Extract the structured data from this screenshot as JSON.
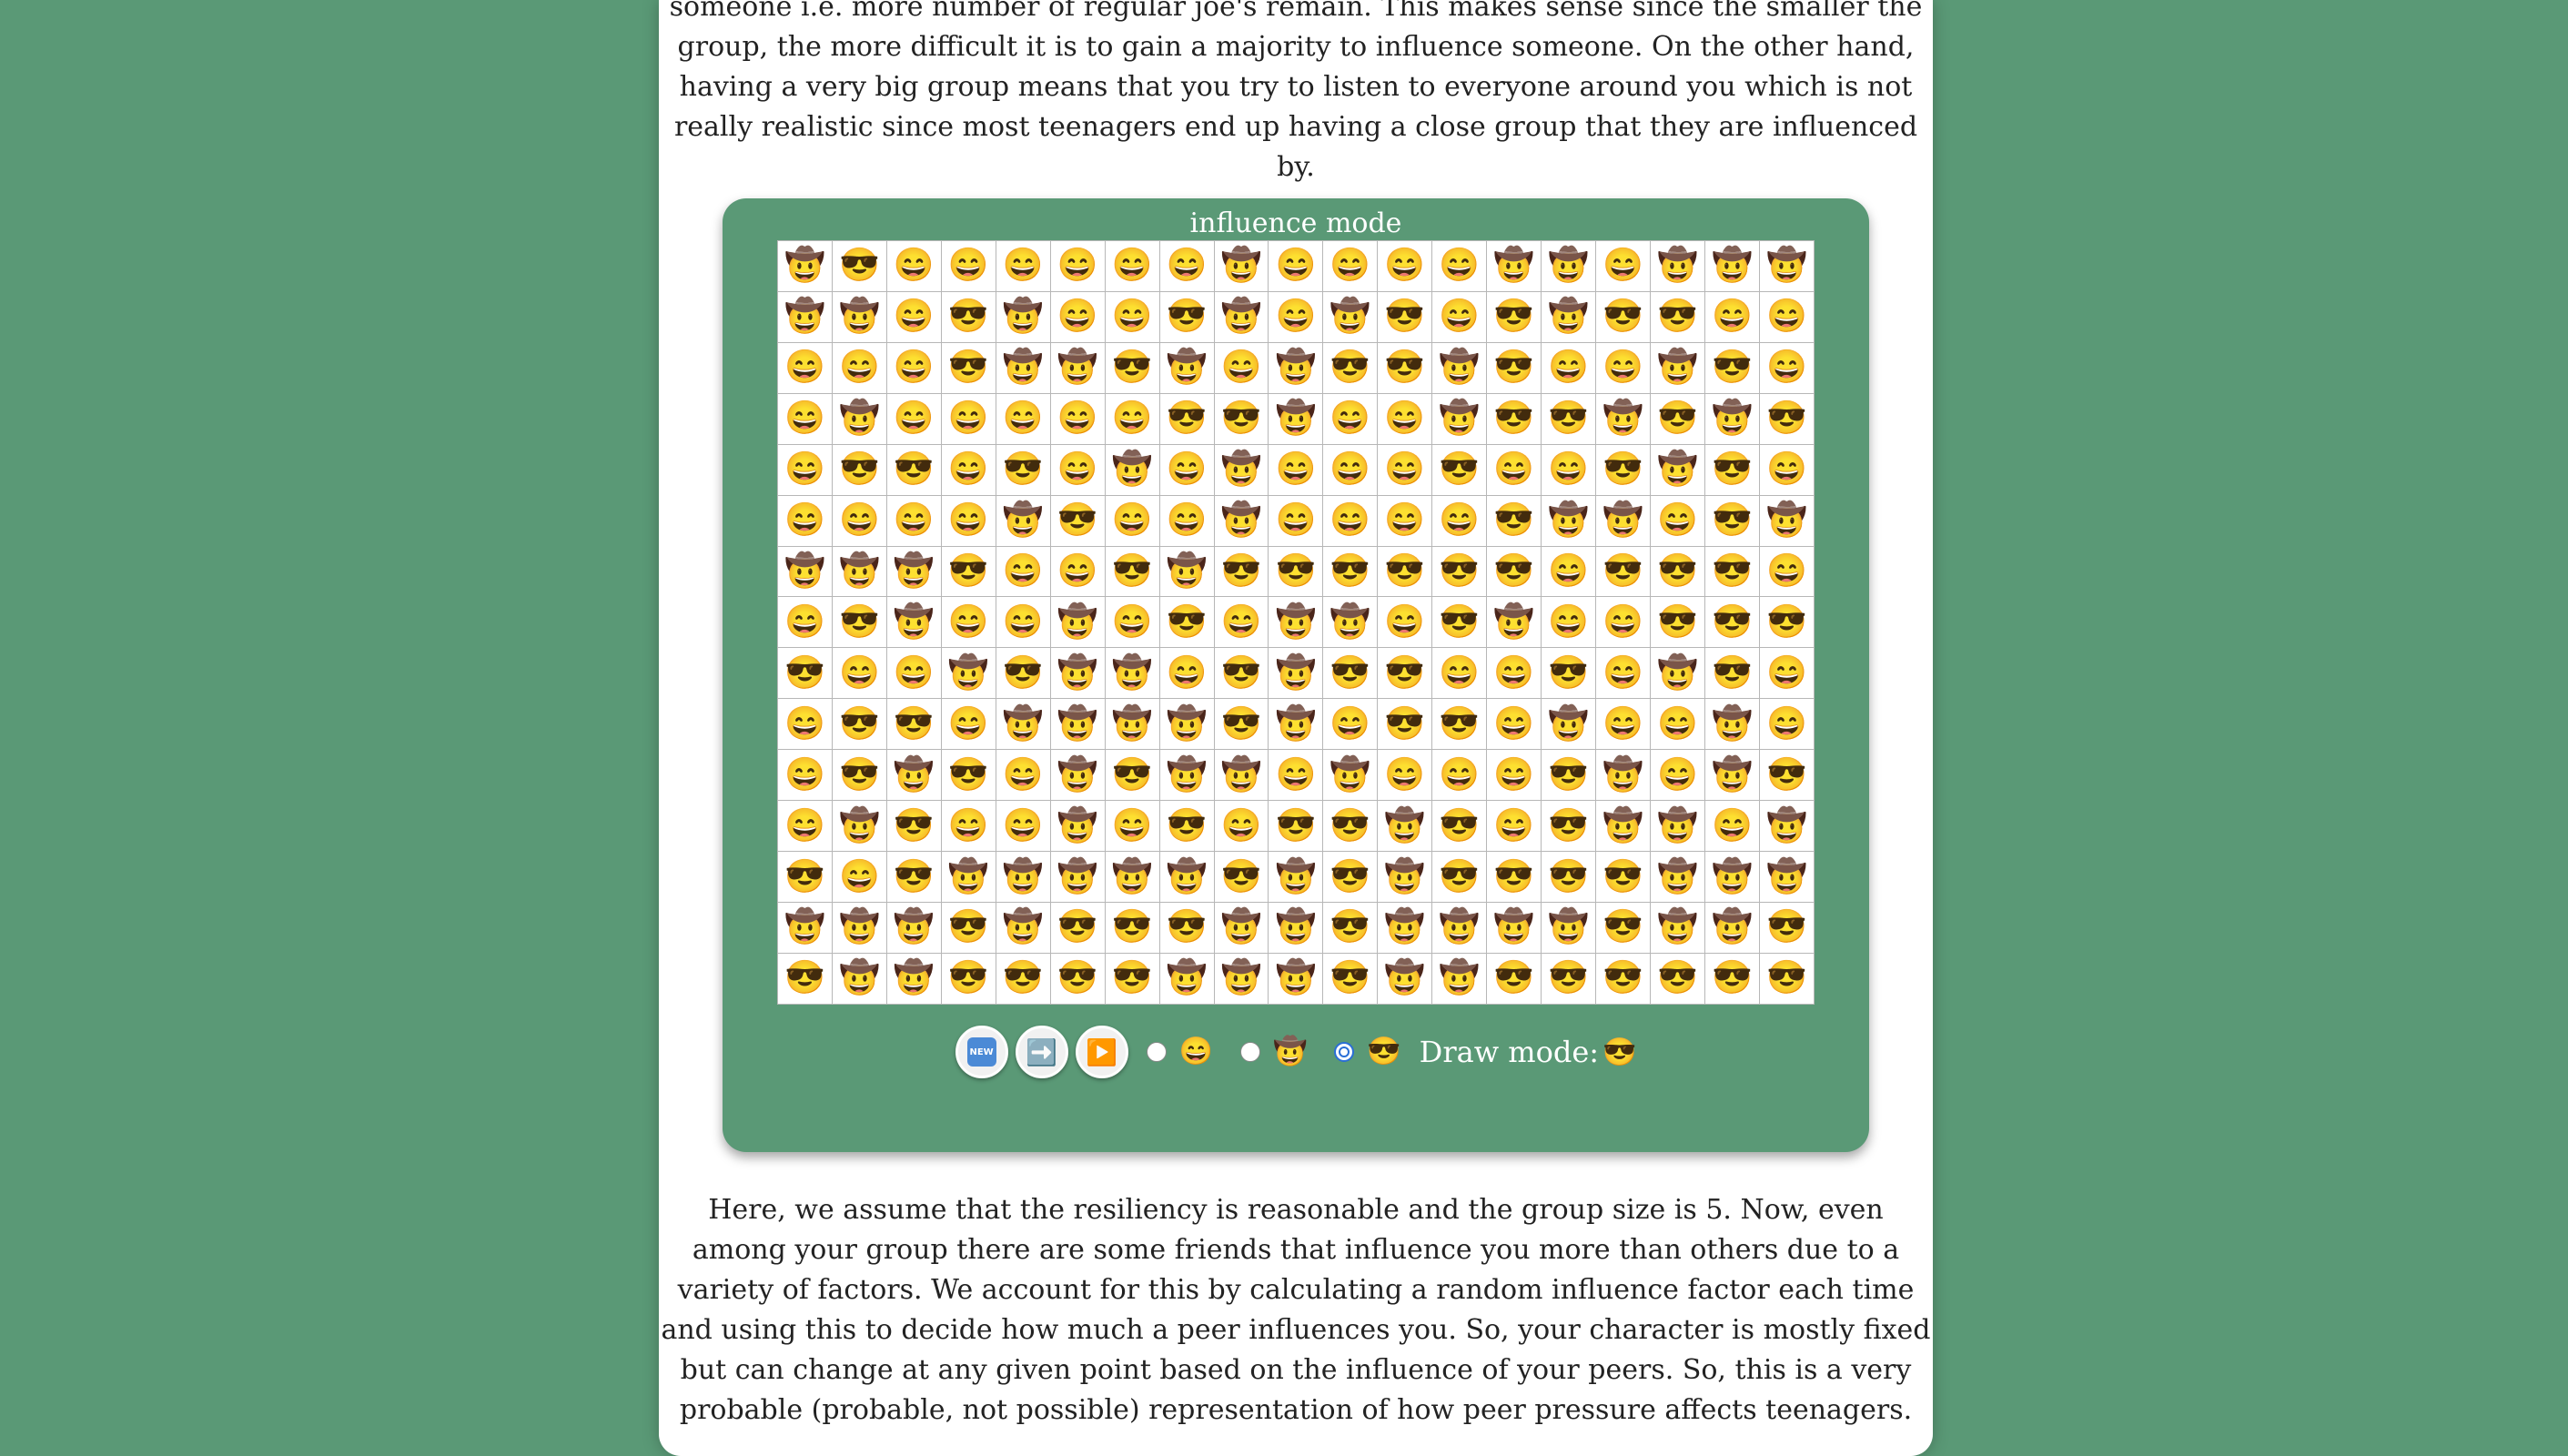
{
  "text": {
    "intro": "someone i.e. more number of regular joe's remain. This makes sense since the smaller the group, the more difficult it is to gain a majority to influence someone. On the other hand, having a very big group means that you try to listen to everyone around you which is not really realistic since most teenagers end up having a close group that they are influenced by.",
    "outro": "Here, we assume that the resiliency is reasonable and the group size is 5. Now, even among your group there are some friends that influence you more than others due to a variety of factors. We account for this by calculating a random influence factor each time and using this to decide how much a peer influences you. So, your character is mostly fixed but can change at any given point based on the influence of your peers. So, this is a very probable (probable, not possible) representation of how peer pressure affects teenagers."
  },
  "widget": {
    "title": "influence mode",
    "new_button_label": "NEW",
    "step_button_icon": "➡️",
    "play_button_icon": "▶️",
    "radio_options": [
      {
        "emoji": "😄",
        "checked": false
      },
      {
        "emoji": "🤠",
        "checked": false
      },
      {
        "emoji": "😎",
        "checked": true
      }
    ],
    "draw_mode_label": "Draw mode:",
    "draw_mode_emoji": "😎"
  },
  "grid": {
    "legend": {
      "H": "😄",
      "C": "🤠",
      "S": "😎"
    },
    "rows": [
      "CSHHHHHHCHHHHCCHCCC",
      "CCHSCHHSCHCSHSCSSHH",
      "HHHSCCSCHCSSCSHHCSH",
      "HCHHHHHSSCHHCSSCSCS",
      "HSSHSHCHCHHHSHHSCSH",
      "HHHHCSHHCHHHHSCCHSC",
      "CCCSHHSCSSSSSSHSSSH",
      "HSCHHCHSHCCHSCHHSSS",
      "SHHCSCCHSCSSHHSHCSH",
      "HSSHCCCCSCHSSHCHHCH",
      "HSCSHCSCCHCHHHSCHCS",
      "HCSHHCHSHSSCSHSCCHC",
      "SHSCCCCCSCSCSSSSCCC",
      "CCCSCSSSCCSCCCCSCCS",
      "SCCSSSSCCCSCCSSSSSS"
    ]
  }
}
